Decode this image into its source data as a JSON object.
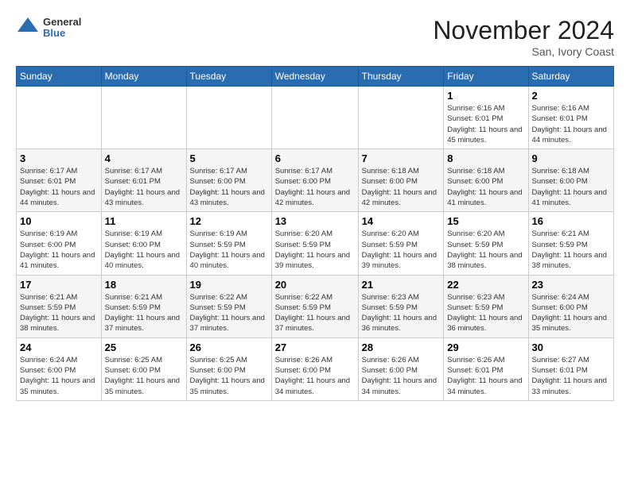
{
  "header": {
    "logo_general": "General",
    "logo_blue": "Blue",
    "month_title": "November 2024",
    "location": "San, Ivory Coast"
  },
  "weekdays": [
    "Sunday",
    "Monday",
    "Tuesday",
    "Wednesday",
    "Thursday",
    "Friday",
    "Saturday"
  ],
  "weeks": [
    [
      {
        "day": "",
        "info": ""
      },
      {
        "day": "",
        "info": ""
      },
      {
        "day": "",
        "info": ""
      },
      {
        "day": "",
        "info": ""
      },
      {
        "day": "",
        "info": ""
      },
      {
        "day": "1",
        "info": "Sunrise: 6:16 AM\nSunset: 6:01 PM\nDaylight: 11 hours and 45 minutes."
      },
      {
        "day": "2",
        "info": "Sunrise: 6:16 AM\nSunset: 6:01 PM\nDaylight: 11 hours and 44 minutes."
      }
    ],
    [
      {
        "day": "3",
        "info": "Sunrise: 6:17 AM\nSunset: 6:01 PM\nDaylight: 11 hours and 44 minutes."
      },
      {
        "day": "4",
        "info": "Sunrise: 6:17 AM\nSunset: 6:01 PM\nDaylight: 11 hours and 43 minutes."
      },
      {
        "day": "5",
        "info": "Sunrise: 6:17 AM\nSunset: 6:00 PM\nDaylight: 11 hours and 43 minutes."
      },
      {
        "day": "6",
        "info": "Sunrise: 6:17 AM\nSunset: 6:00 PM\nDaylight: 11 hours and 42 minutes."
      },
      {
        "day": "7",
        "info": "Sunrise: 6:18 AM\nSunset: 6:00 PM\nDaylight: 11 hours and 42 minutes."
      },
      {
        "day": "8",
        "info": "Sunrise: 6:18 AM\nSunset: 6:00 PM\nDaylight: 11 hours and 41 minutes."
      },
      {
        "day": "9",
        "info": "Sunrise: 6:18 AM\nSunset: 6:00 PM\nDaylight: 11 hours and 41 minutes."
      }
    ],
    [
      {
        "day": "10",
        "info": "Sunrise: 6:19 AM\nSunset: 6:00 PM\nDaylight: 11 hours and 41 minutes."
      },
      {
        "day": "11",
        "info": "Sunrise: 6:19 AM\nSunset: 6:00 PM\nDaylight: 11 hours and 40 minutes."
      },
      {
        "day": "12",
        "info": "Sunrise: 6:19 AM\nSunset: 5:59 PM\nDaylight: 11 hours and 40 minutes."
      },
      {
        "day": "13",
        "info": "Sunrise: 6:20 AM\nSunset: 5:59 PM\nDaylight: 11 hours and 39 minutes."
      },
      {
        "day": "14",
        "info": "Sunrise: 6:20 AM\nSunset: 5:59 PM\nDaylight: 11 hours and 39 minutes."
      },
      {
        "day": "15",
        "info": "Sunrise: 6:20 AM\nSunset: 5:59 PM\nDaylight: 11 hours and 38 minutes."
      },
      {
        "day": "16",
        "info": "Sunrise: 6:21 AM\nSunset: 5:59 PM\nDaylight: 11 hours and 38 minutes."
      }
    ],
    [
      {
        "day": "17",
        "info": "Sunrise: 6:21 AM\nSunset: 5:59 PM\nDaylight: 11 hours and 38 minutes."
      },
      {
        "day": "18",
        "info": "Sunrise: 6:21 AM\nSunset: 5:59 PM\nDaylight: 11 hours and 37 minutes."
      },
      {
        "day": "19",
        "info": "Sunrise: 6:22 AM\nSunset: 5:59 PM\nDaylight: 11 hours and 37 minutes."
      },
      {
        "day": "20",
        "info": "Sunrise: 6:22 AM\nSunset: 5:59 PM\nDaylight: 11 hours and 37 minutes."
      },
      {
        "day": "21",
        "info": "Sunrise: 6:23 AM\nSunset: 5:59 PM\nDaylight: 11 hours and 36 minutes."
      },
      {
        "day": "22",
        "info": "Sunrise: 6:23 AM\nSunset: 5:59 PM\nDaylight: 11 hours and 36 minutes."
      },
      {
        "day": "23",
        "info": "Sunrise: 6:24 AM\nSunset: 6:00 PM\nDaylight: 11 hours and 35 minutes."
      }
    ],
    [
      {
        "day": "24",
        "info": "Sunrise: 6:24 AM\nSunset: 6:00 PM\nDaylight: 11 hours and 35 minutes."
      },
      {
        "day": "25",
        "info": "Sunrise: 6:25 AM\nSunset: 6:00 PM\nDaylight: 11 hours and 35 minutes."
      },
      {
        "day": "26",
        "info": "Sunrise: 6:25 AM\nSunset: 6:00 PM\nDaylight: 11 hours and 35 minutes."
      },
      {
        "day": "27",
        "info": "Sunrise: 6:26 AM\nSunset: 6:00 PM\nDaylight: 11 hours and 34 minutes."
      },
      {
        "day": "28",
        "info": "Sunrise: 6:26 AM\nSunset: 6:00 PM\nDaylight: 11 hours and 34 minutes."
      },
      {
        "day": "29",
        "info": "Sunrise: 6:26 AM\nSunset: 6:01 PM\nDaylight: 11 hours and 34 minutes."
      },
      {
        "day": "30",
        "info": "Sunrise: 6:27 AM\nSunset: 6:01 PM\nDaylight: 11 hours and 33 minutes."
      }
    ]
  ]
}
